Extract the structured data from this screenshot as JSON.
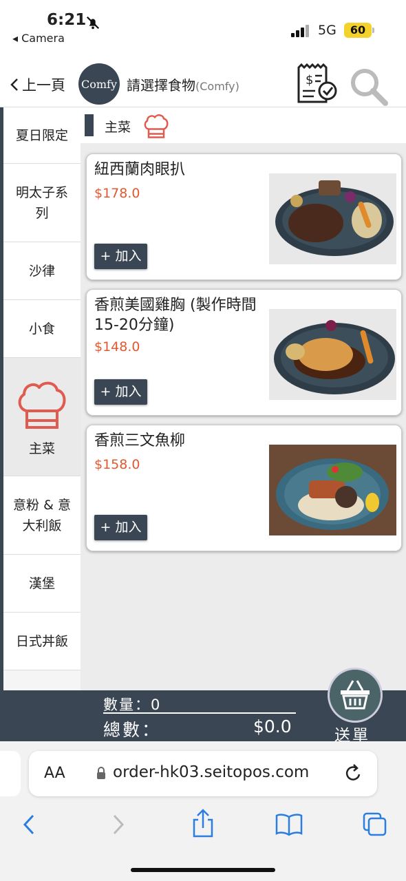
{
  "status_bar": {
    "time": "6:21",
    "back_app": "◂ Camera",
    "network": "5G",
    "battery": "60"
  },
  "header": {
    "back_label": "上一頁",
    "logo_text": "Comfy",
    "title": "請選擇食物",
    "subtitle": "(Comfy)",
    "bill_icon": "receipt-check-icon",
    "search_icon": "search-icon"
  },
  "sidebar": {
    "items": [
      {
        "label": "夏日限定"
      },
      {
        "label": "明太子系列"
      },
      {
        "label": "沙律"
      },
      {
        "label": "小食"
      },
      {
        "label": "主菜",
        "active": true,
        "icon": "chef-hat-icon"
      },
      {
        "label": "意粉 & 意大利飯"
      },
      {
        "label": "漢堡"
      },
      {
        "label": "日式丼飯"
      }
    ]
  },
  "section": {
    "title": "主菜",
    "icon": "chef-hat-icon"
  },
  "products": [
    {
      "name": "紐西蘭肉眼扒",
      "price": "$178.0",
      "add_label": "+ 加入"
    },
    {
      "name": "香煎美國雞胸 (製作時間15-20分鐘)",
      "price": "$148.0",
      "add_label": "+ 加入"
    },
    {
      "name": "香煎三文魚柳",
      "price": "$158.0",
      "add_label": "+ 加入"
    }
  ],
  "order_bar": {
    "quantity_label": "數量：",
    "quantity": "0",
    "total_label": "總數：",
    "total": "$0.0",
    "submit_label": "送單"
  },
  "browser": {
    "aa": "AA",
    "url": "order-hk03.seitopos.com"
  },
  "colors": {
    "primary": "#3b4654",
    "accent": "#e2582f",
    "hat": "#e05a4f"
  }
}
